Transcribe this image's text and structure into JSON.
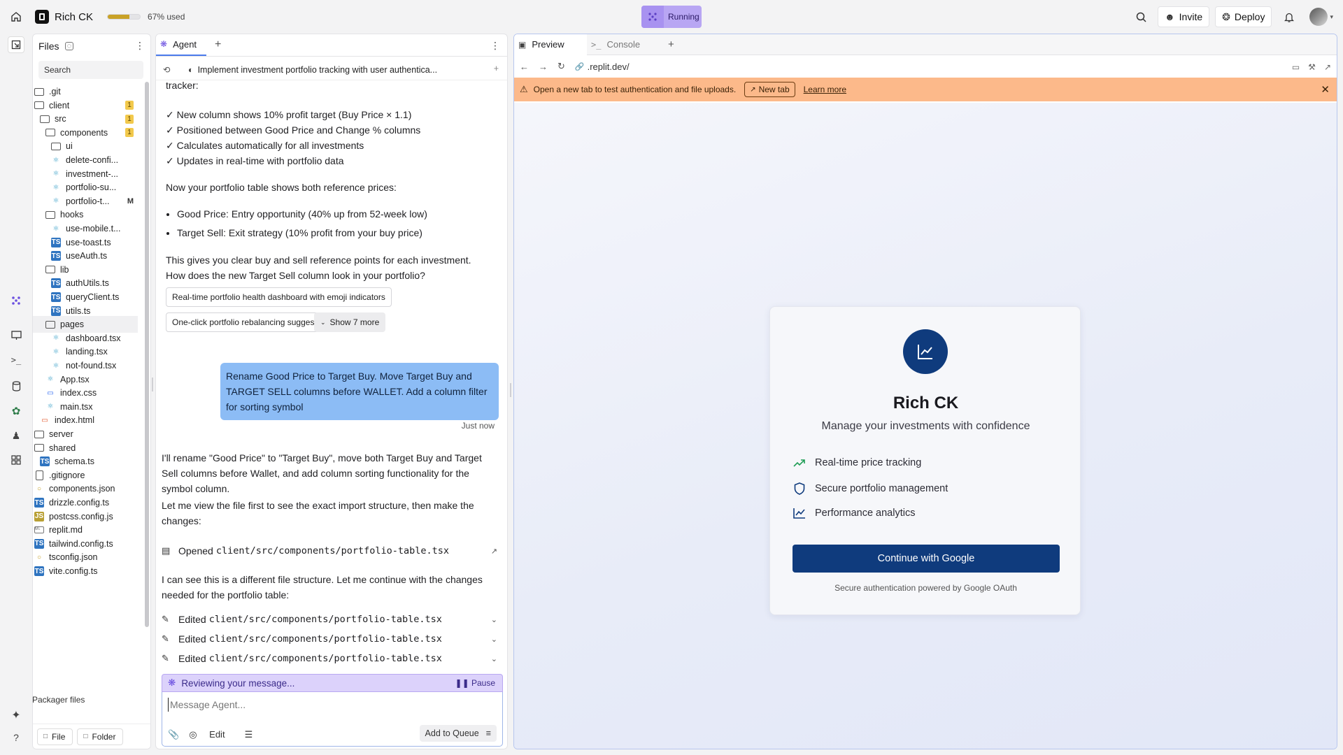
{
  "topbar": {
    "app_name": "Rich CK",
    "usage_text": "67% used",
    "usage_fraction": 0.67,
    "status": "Running",
    "invite_label": "Invite",
    "deploy_label": "Deploy"
  },
  "files": {
    "title": "Files",
    "search_placeholder": "Search",
    "tree": [
      {
        "name": ".git",
        "type": "folder",
        "depth": 0
      },
      {
        "name": "client",
        "type": "folder",
        "depth": 0,
        "badge": "1"
      },
      {
        "name": "src",
        "type": "folder",
        "depth": 1,
        "badge": "1"
      },
      {
        "name": "components",
        "type": "folder",
        "depth": 2,
        "badge": "1"
      },
      {
        "name": "ui",
        "type": "folder",
        "depth": 3
      },
      {
        "name": "delete-confi...",
        "type": "react",
        "depth": 3
      },
      {
        "name": "investment-...",
        "type": "react",
        "depth": 3
      },
      {
        "name": "portfolio-su...",
        "type": "react",
        "depth": 3
      },
      {
        "name": "portfolio-t...",
        "type": "react",
        "depth": 3,
        "mark": "M"
      },
      {
        "name": "hooks",
        "type": "folder",
        "depth": 2
      },
      {
        "name": "use-mobile.t...",
        "type": "react",
        "depth": 3
      },
      {
        "name": "use-toast.ts",
        "type": "ts",
        "depth": 3
      },
      {
        "name": "useAuth.ts",
        "type": "ts",
        "depth": 3
      },
      {
        "name": "lib",
        "type": "folder",
        "depth": 2
      },
      {
        "name": "authUtils.ts",
        "type": "ts",
        "depth": 3
      },
      {
        "name": "queryClient.ts",
        "type": "ts",
        "depth": 3
      },
      {
        "name": "utils.ts",
        "type": "ts",
        "depth": 3
      },
      {
        "name": "pages",
        "type": "folder",
        "depth": 2,
        "selected": true
      },
      {
        "name": "dashboard.tsx",
        "type": "react",
        "depth": 3
      },
      {
        "name": "landing.tsx",
        "type": "react",
        "depth": 3
      },
      {
        "name": "not-found.tsx",
        "type": "react",
        "depth": 3
      },
      {
        "name": "App.tsx",
        "type": "react",
        "depth": 2
      },
      {
        "name": "index.css",
        "type": "css",
        "depth": 2
      },
      {
        "name": "main.tsx",
        "type": "react",
        "depth": 2
      },
      {
        "name": "index.html",
        "type": "html",
        "depth": 1
      },
      {
        "name": "server",
        "type": "folder",
        "depth": 0
      },
      {
        "name": "shared",
        "type": "folder",
        "depth": 0
      },
      {
        "name": "schema.ts",
        "type": "ts",
        "depth": 1
      },
      {
        "name": ".gitignore",
        "type": "file",
        "depth": 0
      },
      {
        "name": "components.json",
        "type": "json",
        "depth": 0
      },
      {
        "name": "drizzle.config.ts",
        "type": "ts",
        "depth": 0
      },
      {
        "name": "postcss.config.js",
        "type": "js",
        "depth": 0
      },
      {
        "name": "replit.md",
        "type": "md",
        "depth": 0
      },
      {
        "name": "tailwind.config.ts",
        "type": "ts",
        "depth": 0
      },
      {
        "name": "tsconfig.json",
        "type": "json",
        "depth": 0
      },
      {
        "name": "vite.config.ts",
        "type": "ts",
        "depth": 0
      }
    ],
    "packager_label": "Packager files",
    "file_button": "File",
    "folder_button": "Folder"
  },
  "agent": {
    "tab_label": "Agent",
    "task_title": "Implement investment portfolio tracking with user authentica...",
    "msg_tracker": "tracker:",
    "checks": [
      "✓ New column shows 10% profit target (Buy Price × 1.1)",
      "✓ Positioned between Good Price and Change % columns",
      "✓ Calculates automatically for all investments",
      "✓ Updates in real-time with portfolio data"
    ],
    "msg_reference": "Now your portfolio table shows both reference prices:",
    "bullets": [
      "Good Price: Entry opportunity (40% up from 52-week low)",
      "Target Sell: Exit strategy (10% profit from your buy price)"
    ],
    "msg_clear_1": "This gives you clear buy and sell reference points for each investment.",
    "msg_clear_2": "How does the new Target Sell column look in your portfolio?",
    "suggestion_1": "Real-time portfolio health dashboard with emoji indicators",
    "suggestion_2": "One-click portfolio rebalancing suggestions",
    "show_more": "Show 7 more",
    "user_message": "Rename Good Price to Target Buy. Move Target Buy and TARGET SELL columns before WALLET. Add a column filter for sorting symbol",
    "user_time": "Just now",
    "reply_1": "I'll rename \"Good Price\" to \"Target Buy\", move both Target Buy and Target Sell columns before Wallet, and add column sorting functionality for the symbol column.",
    "reply_2": "Let me view the file first to see the exact import structure, then make the changes:",
    "opened_label": "Opened",
    "opened_path": "client/src/components/portfolio-table.tsx",
    "reply_3": "I can see this is a different file structure. Let me continue with the changes needed for the portfolio table:",
    "edited_label": "Edited",
    "edited_path": "client/src/components/portfolio-table.tsx",
    "reviewing": "Reviewing your message...",
    "pause": "Pause",
    "input_placeholder": "Message Agent...",
    "edit_label": "Edit",
    "queue_label": "Add to Queue"
  },
  "preview": {
    "tab_preview": "Preview",
    "tab_console": "Console",
    "url": ".replit.dev/",
    "banner_text": "Open a new tab to test authentication and file uploads.",
    "banner_newtab": "New tab",
    "banner_learn": "Learn more",
    "card": {
      "title": "Rich CK",
      "subtitle": "Manage your investments with confidence",
      "features": [
        "Real-time price tracking",
        "Secure portfolio management",
        "Performance analytics"
      ],
      "cta": "Continue with Google",
      "footer": "Secure authentication powered by Google OAuth"
    }
  },
  "colors": {
    "brand_navy": "#0f3b7d",
    "running_purple": "#b8a6f3",
    "banner_orange": "#fcb98a",
    "user_bubble": "#8cbcf5",
    "accent_green": "#1f9d55"
  }
}
